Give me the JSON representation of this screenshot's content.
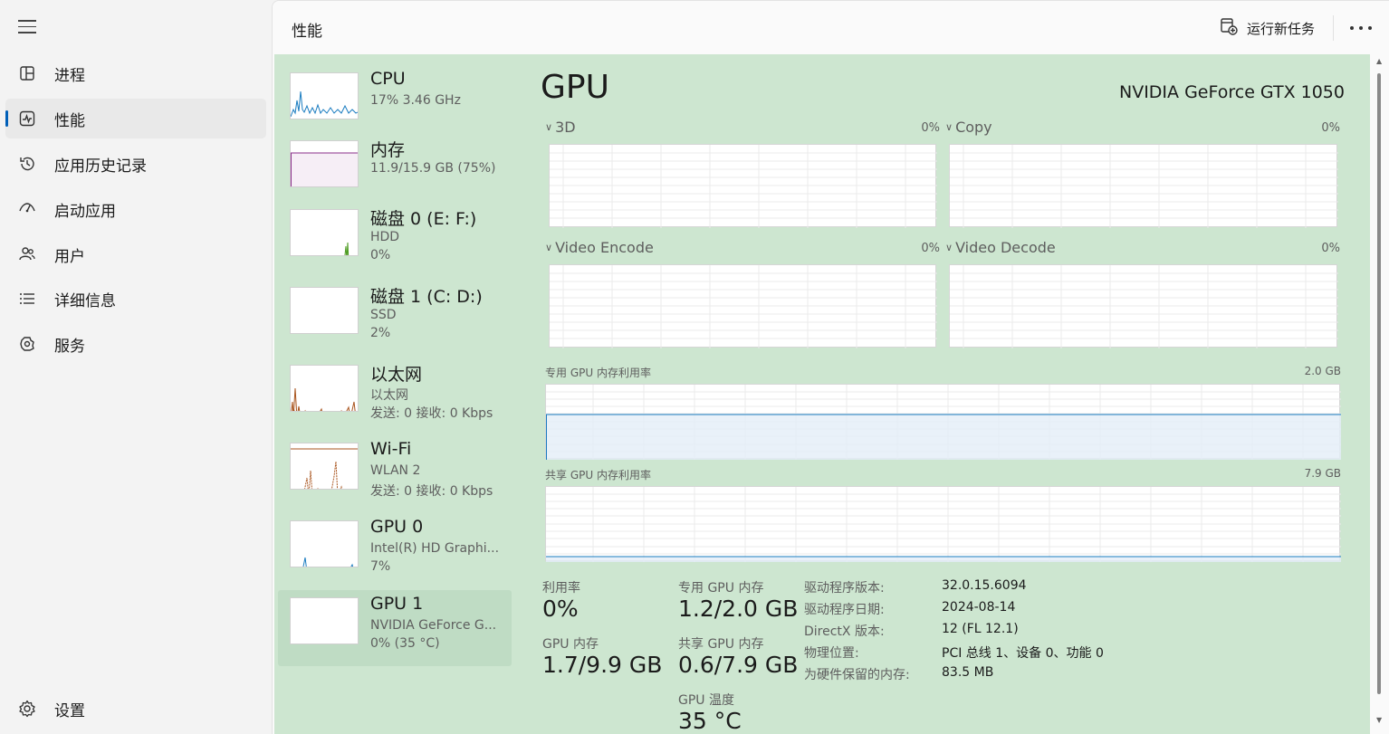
{
  "nav": {
    "items": [
      {
        "label": "进程",
        "icon": "processes-icon"
      },
      {
        "label": "性能",
        "icon": "performance-icon"
      },
      {
        "label": "应用历史记录",
        "icon": "history-icon"
      },
      {
        "label": "启动应用",
        "icon": "startup-icon"
      },
      {
        "label": "用户",
        "icon": "users-icon"
      },
      {
        "label": "详细信息",
        "icon": "details-icon"
      },
      {
        "label": "服务",
        "icon": "services-icon"
      }
    ],
    "active_index": 1,
    "settings_label": "设置"
  },
  "header": {
    "title": "性能",
    "run_task_label": "运行新任务"
  },
  "devices": [
    {
      "name": "CPU",
      "line1": "17% 3.46 GHz",
      "line2": "",
      "color": "#1a7cc0"
    },
    {
      "name": "内存",
      "line1": "11.9/15.9 GB (75%)",
      "line2": "",
      "color": "#8b2f8b"
    },
    {
      "name": "磁盘 0 (E: F:)",
      "line1": "HDD",
      "line2": "0%",
      "color": "#4a9a1e"
    },
    {
      "name": "磁盘 1 (C: D:)",
      "line1": "SSD",
      "line2": "2%",
      "color": "#4a9a1e"
    },
    {
      "name": "以太网",
      "line1": "以太网",
      "line2": "发送: 0 接收: 0 Kbps",
      "color": "#a8531c"
    },
    {
      "name": "Wi-Fi",
      "line1": "WLAN 2",
      "line2": "发送: 0 接收: 0 Kbps",
      "color": "#a8531c"
    },
    {
      "name": "GPU 0",
      "line1": "Intel(R) HD Graphi...",
      "line2": "7%",
      "color": "#1a7cc0"
    },
    {
      "name": "GPU 1",
      "line1": "NVIDIA GeForce G...",
      "line2": "0% (35 °C)",
      "color": "#1a7cc0"
    }
  ],
  "selected_device_index": 7,
  "gpu": {
    "title": "GPU",
    "model": "NVIDIA GeForce GTX 1050",
    "engines": [
      {
        "label": "3D",
        "pct": "0%"
      },
      {
        "label": "Copy",
        "pct": "0%"
      },
      {
        "label": "Video Encode",
        "pct": "0%"
      },
      {
        "label": "Video Decode",
        "pct": "0%"
      }
    ],
    "dedicated_mem_label": "专用 GPU 内存利用率",
    "dedicated_mem_max": "2.0 GB",
    "dedicated_mem_fraction": 0.6,
    "shared_mem_label": "共享 GPU 内存利用率",
    "shared_mem_max": "7.9 GB",
    "shared_mem_fraction": 0.076,
    "stats": {
      "utilization_label": "利用率",
      "utilization_value": "0%",
      "dedicated_label": "专用 GPU 内存",
      "dedicated_value": "1.2/2.0 GB",
      "gpu_mem_label": "GPU 内存",
      "gpu_mem_value": "1.7/9.9 GB",
      "shared_label": "共享 GPU 内存",
      "shared_value": "0.6/7.9 GB",
      "temp_label": "GPU 温度",
      "temp_value": "35 °C"
    },
    "info": [
      {
        "label": "驱动程序版本:",
        "value": "32.0.15.6094"
      },
      {
        "label": "驱动程序日期:",
        "value": "2024-08-14"
      },
      {
        "label": "DirectX 版本:",
        "value": "12 (FL 12.1)"
      },
      {
        "label": "物理位置:",
        "value": "PCI 总线 1、设备 0、功能 0"
      },
      {
        "label": "为硬件保留的内存:",
        "value": "83.5 MB"
      }
    ]
  },
  "colors": {
    "accent": "#005fb8",
    "content_bg": "#cde6d0",
    "graph_line": "#1a7cc0"
  }
}
